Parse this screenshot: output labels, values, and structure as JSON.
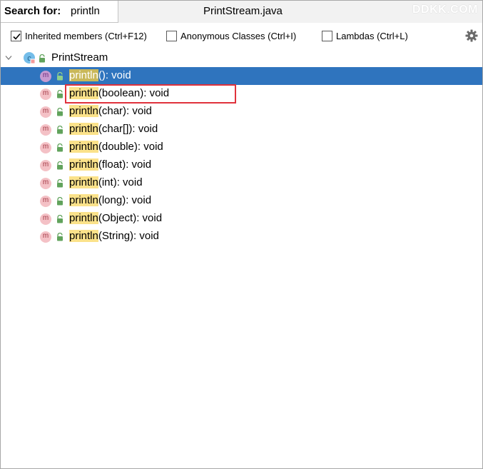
{
  "header": {
    "search_label": "Search for:",
    "search_value": "println",
    "file_name": "PrintStream.java",
    "watermark": "DDKK.COM"
  },
  "options": [
    {
      "label": "Inherited members (Ctrl+F12)",
      "checked": true
    },
    {
      "label": "Anonymous Classes (Ctrl+I)",
      "checked": false
    },
    {
      "label": "Lambdas (Ctrl+L)",
      "checked": false
    }
  ],
  "tree": {
    "root": {
      "label": "PrintStream",
      "icon": "class-icon",
      "badge": "c"
    },
    "method_badge": "m",
    "methods": [
      {
        "match": "println",
        "rest": "(): void",
        "selected": true
      },
      {
        "match": "println",
        "rest": "(boolean): void",
        "selected": false
      },
      {
        "match": "println",
        "rest": "(char): void",
        "selected": false
      },
      {
        "match": "println",
        "rest": "(char[]): void",
        "selected": false
      },
      {
        "match": "println",
        "rest": "(double): void",
        "selected": false
      },
      {
        "match": "println",
        "rest": "(float): void",
        "selected": false
      },
      {
        "match": "println",
        "rest": "(int): void",
        "selected": false
      },
      {
        "match": "println",
        "rest": "(long): void",
        "selected": false
      },
      {
        "match": "println",
        "rest": "(Object): void",
        "selected": false
      },
      {
        "match": "println",
        "rest": "(String): void",
        "selected": false
      }
    ]
  },
  "colors": {
    "selection": "#2f74be",
    "match_highlight": "#fbe28a",
    "annotation_box": "#e0323c"
  }
}
